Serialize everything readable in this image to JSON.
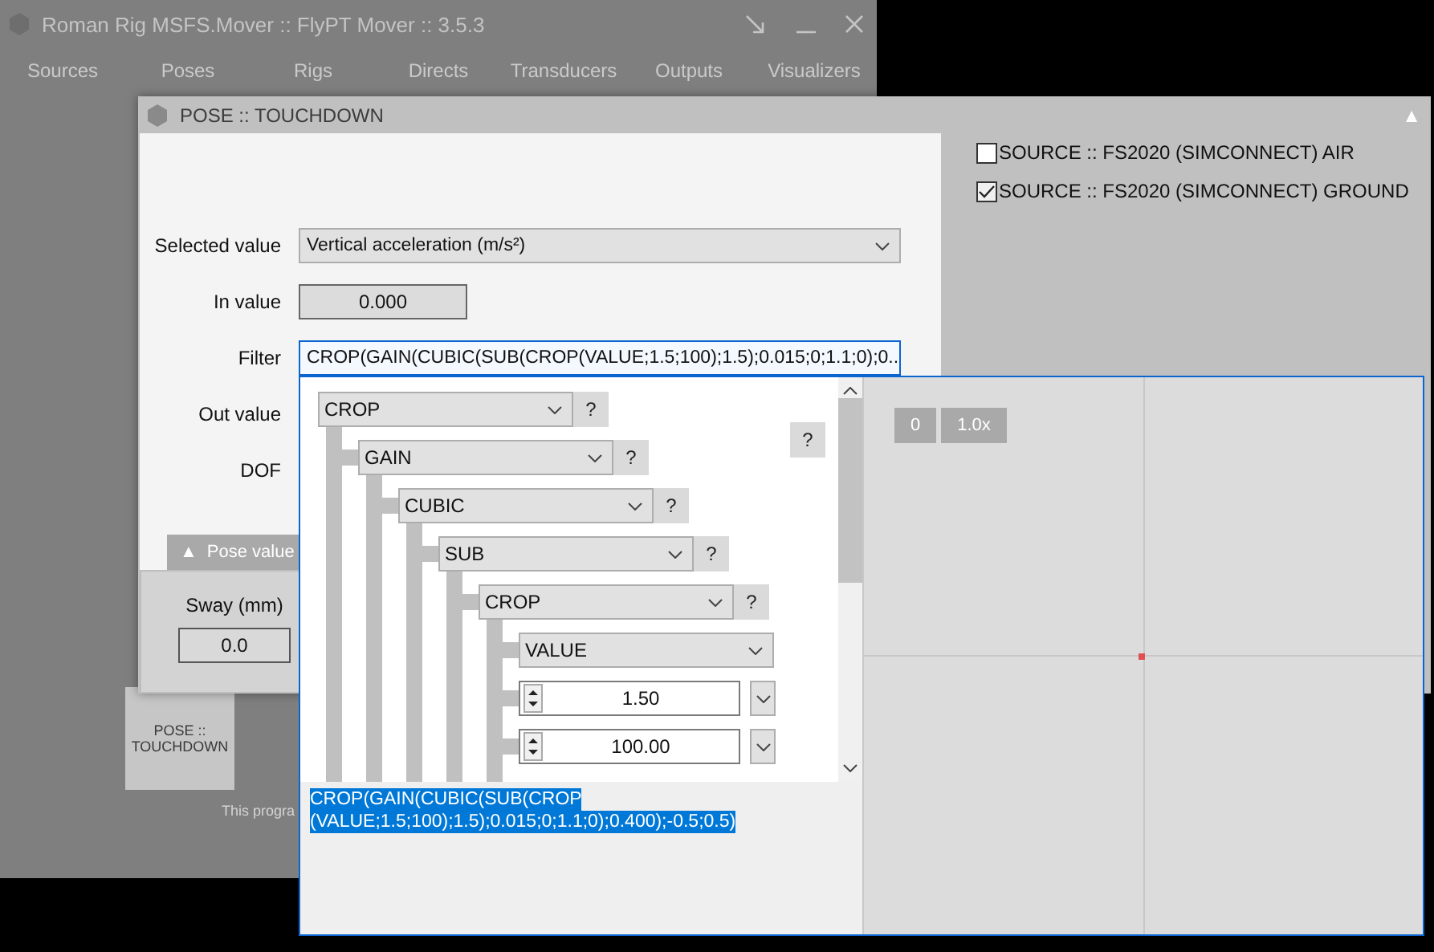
{
  "main_window": {
    "title": "Roman Rig MSFS.Mover :: FlyPT Mover :: 3.5.3",
    "tabs": [
      {
        "label": "Sources"
      },
      {
        "label": "Poses"
      },
      {
        "label": "Rigs"
      },
      {
        "label": "Directs"
      },
      {
        "label": "Transducers"
      },
      {
        "label": "Outputs"
      },
      {
        "label": "Visualizers"
      }
    ],
    "tile": {
      "label": "POSE :: TOUCHDOWN"
    },
    "footer_text": "This progra"
  },
  "pose_window": {
    "title": "POSE :: TOUCHDOWN",
    "collapse_glyph": "▲",
    "fields": [
      {
        "label": "Selected value",
        "kind": "select",
        "value": "Vertical acceleration (m/s²)",
        "focused": false
      },
      {
        "label": "In value",
        "kind": "readout",
        "value": "0.000"
      },
      {
        "label": "Filter",
        "kind": "select",
        "value": "CROP(GAIN(CUBIC(SUB(CROP(VALUE;1.5;100);1.5);0.015;0;1.1;0);0...",
        "focused": true
      },
      {
        "label": "Out value",
        "kind": "hidden"
      },
      {
        "label": "DOF",
        "kind": "hidden"
      }
    ],
    "pose_value": {
      "toggle": "▲",
      "title": "Pose value",
      "items": [
        {
          "label": "Sway (mm)",
          "value": "0.0"
        }
      ]
    },
    "sources": [
      {
        "label": "SOURCE :: FS2020 (SIMCONNECT) AIR",
        "checked": false
      },
      {
        "label": "SOURCE :: FS2020 (SIMCONNECT) GROUND",
        "checked": true
      }
    ]
  },
  "filter_popup": {
    "help_label": "?",
    "tree": {
      "kind": "function",
      "label": "CROP",
      "help": "?",
      "children": [
        {
          "kind": "function",
          "label": "GAIN",
          "help": "?",
          "children": [
            {
              "kind": "function",
              "label": "CUBIC",
              "help": "?",
              "children": [
                {
                  "kind": "function",
                  "label": "SUB",
                  "help": "?",
                  "children": [
                    {
                      "kind": "function",
                      "label": "CROP",
                      "help": "?",
                      "children": [
                        {
                          "kind": "select",
                          "label": "VALUE"
                        },
                        {
                          "kind": "number",
                          "value": "1.50"
                        },
                        {
                          "kind": "number",
                          "value": "100.00"
                        }
                      ]
                    }
                  ]
                }
              ]
            }
          ]
        }
      ]
    },
    "expression": {
      "selected": true,
      "lines": [
        "CROP(GAIN(CUBIC(SUB(CROP",
        "(VALUE;1.5;100);1.5);0.015;0;1.1;0);0.400);-0.5;0.5)"
      ]
    },
    "preview_buttons": [
      "0",
      "1.0x"
    ]
  }
}
